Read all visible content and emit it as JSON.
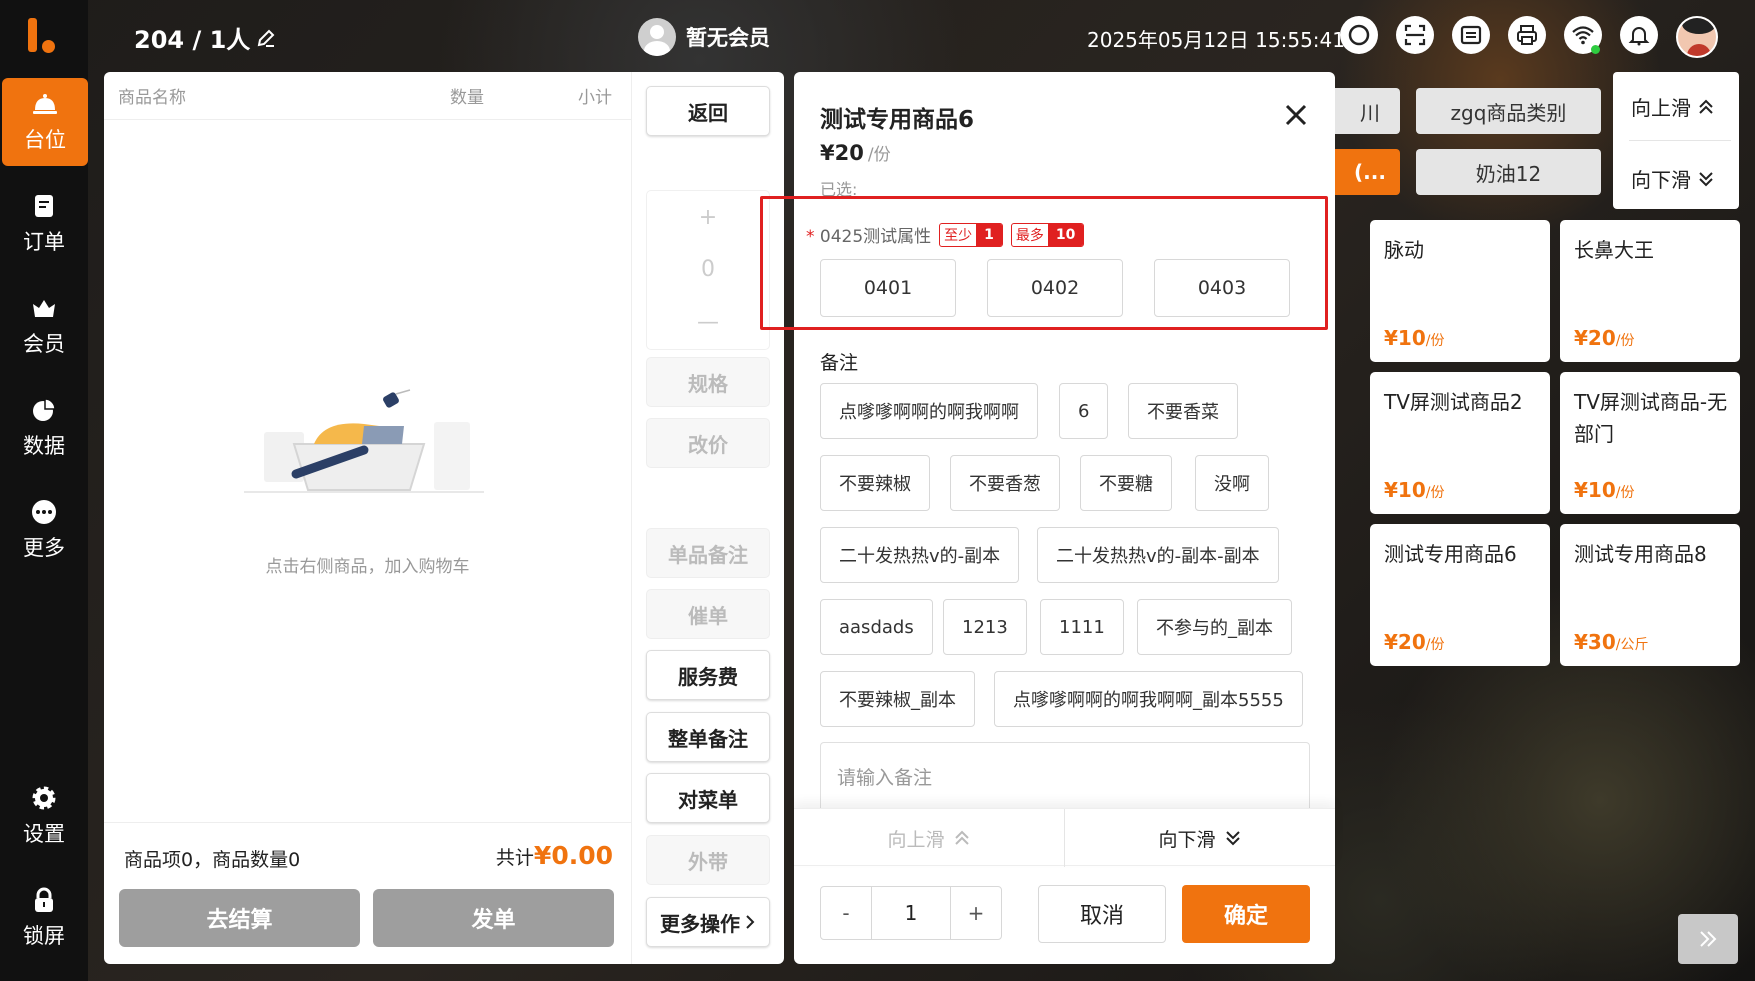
{
  "header": {
    "table_info": "204 / 1人",
    "member": "暂无会员",
    "datetime": "2025年05月12日 15:55:41"
  },
  "nav": {
    "items": [
      {
        "label": "台位",
        "icon": "table-icon",
        "active": true
      },
      {
        "label": "订单",
        "icon": "order-icon"
      },
      {
        "label": "会员",
        "icon": "member-icon"
      },
      {
        "label": "数据",
        "icon": "chart-icon"
      },
      {
        "label": "更多",
        "icon": "more-icon"
      },
      {
        "label": "设置",
        "icon": "gear-icon"
      },
      {
        "label": "锁屏",
        "icon": "lock-icon"
      }
    ]
  },
  "cart": {
    "col_name": "商品名称",
    "col_qty": "数量",
    "col_subtotal": "小计",
    "empty_text": "点击右侧商品，加入购物车",
    "summary": "商品项0，商品数量0",
    "total_label": "共计",
    "total_value": "¥0.00",
    "checkout_label": "去结算",
    "send_label": "发单"
  },
  "ops": {
    "back": "返回",
    "plus": "+",
    "qty": "0",
    "minus": "—",
    "spec": "规格",
    "reprice": "改价",
    "item_note": "单品备注",
    "urge": "催单",
    "service_fee": "服务费",
    "order_note": "整单备注",
    "check_menu": "对菜单",
    "takeaway": "外带",
    "more": "更多操作"
  },
  "categories": {
    "partial_top": "川",
    "zgq": "zgq商品类别",
    "partial_active": "(...",
    "cream": "奶油12",
    "scroll_up": "向上滑",
    "scroll_down": "向下滑"
  },
  "products": [
    {
      "name": "脉动",
      "price": "¥10",
      "unit": "/份"
    },
    {
      "name": "长鼻大王",
      "price": "¥20",
      "unit": "/份"
    },
    {
      "name": "TV屏测试商品2",
      "price": "¥10",
      "unit": "/份"
    },
    {
      "name": "TV屏测试商品-无部门",
      "price": "¥10",
      "unit": "/份"
    },
    {
      "name": "测试专用商品6",
      "price": "¥20",
      "unit": "/份"
    },
    {
      "name": "测试专用商品8",
      "price": "¥30",
      "unit": "/公斤"
    }
  ],
  "modal": {
    "title": "测试专用商品6",
    "price": "¥20",
    "unit": "/份",
    "selected_label": "已选:",
    "attr_star": "*",
    "attr_name": "0425测试属性",
    "min_label": "至少",
    "min_value": "1",
    "max_label": "最多",
    "max_value": "10",
    "options": [
      "0401",
      "0402",
      "0403"
    ],
    "remark_label": "备注",
    "remarks": [
      "点嗲嗲啊啊的啊我啊啊",
      "6",
      "不要香菜",
      "不要辣椒",
      "不要香葱",
      "不要糖",
      "没啊",
      "二十发热热v的-副本",
      "二十发热热v的-副本-副本",
      "aasdads",
      "1213",
      "1111",
      "不参与的_副本",
      "不要辣椒_副本",
      "点嗲嗲啊啊的啊我啊啊_副本5555"
    ],
    "remark_placeholder": "请输入备注",
    "scroll_up": "向上滑",
    "scroll_down": "向下滑",
    "qty_minus": "-",
    "qty_value": "1",
    "qty_plus": "+",
    "cancel": "取消",
    "confirm": "确定"
  },
  "colors": {
    "accent": "#f0730f",
    "highlight": "#e02020"
  }
}
